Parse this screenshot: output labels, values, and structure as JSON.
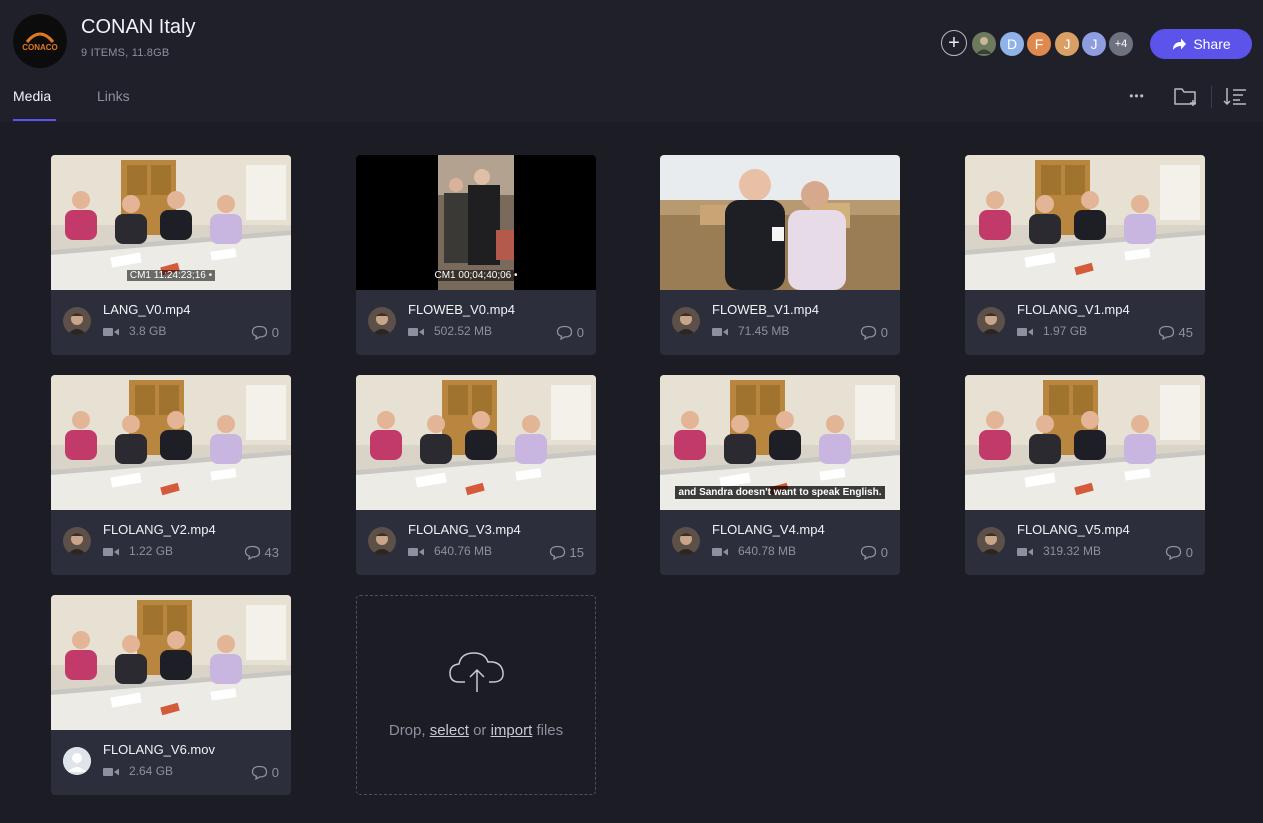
{
  "project": {
    "title": "CONAN Italy",
    "meta": "9 ITEMS, 11.8GB",
    "logo_text": "CONACO"
  },
  "collaborators": {
    "add_label": "+",
    "avatars": [
      {
        "initial": "",
        "color": "#6d7a5e"
      },
      {
        "initial": "D",
        "color": "#8fb3e8"
      },
      {
        "initial": "F",
        "color": "#e0894f"
      },
      {
        "initial": "J",
        "color": "#d9a065"
      },
      {
        "initial": "J",
        "color": "#8e9ce0"
      }
    ],
    "more": "+4"
  },
  "share_label": "Share",
  "tabs": {
    "media": "Media",
    "links": "Links"
  },
  "toolbar": {
    "more": "•••"
  },
  "assets": [
    {
      "name": "LANG_V0.mp4",
      "size": "3.8 GB",
      "comments": "0",
      "timecode": "CM1 11:24:23;16 •",
      "scene": "room"
    },
    {
      "name": "FLOWEB_V0.mp4",
      "size": "502.52 MB",
      "comments": "0",
      "timecode": "CM1 00;04;40;06 •",
      "scene": "vertical"
    },
    {
      "name": "FLOWEB_V1.mp4",
      "size": "71.45 MB",
      "comments": "0",
      "scene": "outdoor"
    },
    {
      "name": "FLOLANG_V1.mp4",
      "size": "1.97 GB",
      "comments": "45",
      "scene": "room"
    },
    {
      "name": "FLOLANG_V2.mp4",
      "size": "1.22 GB",
      "comments": "43",
      "scene": "room"
    },
    {
      "name": "FLOLANG_V3.mp4",
      "size": "640.76 MB",
      "comments": "15",
      "scene": "room"
    },
    {
      "name": "FLOLANG_V4.mp4",
      "size": "640.78 MB",
      "comments": "0",
      "subtitle": "and Sandra doesn't want to speak English.",
      "scene": "room"
    },
    {
      "name": "FLOLANG_V5.mp4",
      "size": "319.32 MB",
      "comments": "0",
      "scene": "room"
    },
    {
      "name": "FLOLANG_V6.mov",
      "size": "2.64 GB",
      "comments": "0",
      "scene": "room",
      "uploader": "generic"
    }
  ],
  "upload": {
    "prefix": "Drop,",
    "select": "select",
    "middle": "or",
    "import": "import",
    "suffix": "files"
  },
  "colors": {
    "accent": "#5b53ea",
    "background": "#1b1c24",
    "card": "#2c2e3b"
  }
}
